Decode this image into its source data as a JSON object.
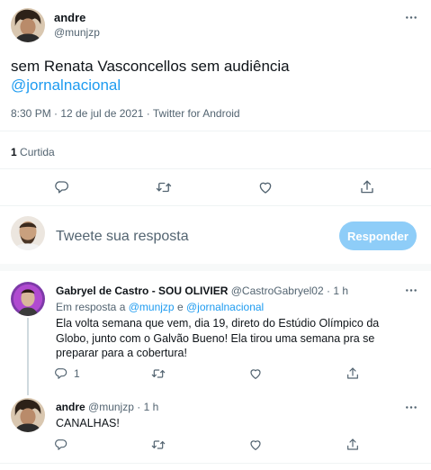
{
  "tweet": {
    "display_name": "andre",
    "handle": "@munjzp",
    "text": "sem Renata Vasconcellos sem audiência",
    "mention": "@jornalnacional",
    "meta": "8:30 PM · 12 de jul de 2021 · Twitter for Android",
    "likes_count": "1",
    "likes_label": "Curtida"
  },
  "composer": {
    "placeholder": "Tweete sua resposta",
    "reply_button": "Responder"
  },
  "replies": [
    {
      "display_name": "Gabryel de Castro - SOU OLIVIER",
      "handle": "@CastroGabryel02",
      "dot": "·",
      "time": "1 h",
      "in_reply_prefix": "Em resposta a",
      "in_reply_user1": "@munjzp",
      "in_reply_and": "e",
      "in_reply_user2": "@jornalnacional",
      "text": "Ela volta semana que vem, dia 19, direto do Estúdio Olímpico da Globo, junto com o Galvão Bueno! Ela tirou uma semana pra se preparar para a cobertura!",
      "reply_count": "1"
    },
    {
      "display_name": "andre",
      "handle": "@munjzp",
      "dot": "·",
      "time": "1 h",
      "text": "CANALHAS!"
    }
  ],
  "icons": [
    "more-icon",
    "reply-icon",
    "retweet-icon",
    "like-icon",
    "share-icon"
  ],
  "colors": {
    "accent": "#1d9bf0",
    "reply_button_bg": "#8ecdf8",
    "muted": "#536471",
    "divider": "#eff3f4"
  }
}
